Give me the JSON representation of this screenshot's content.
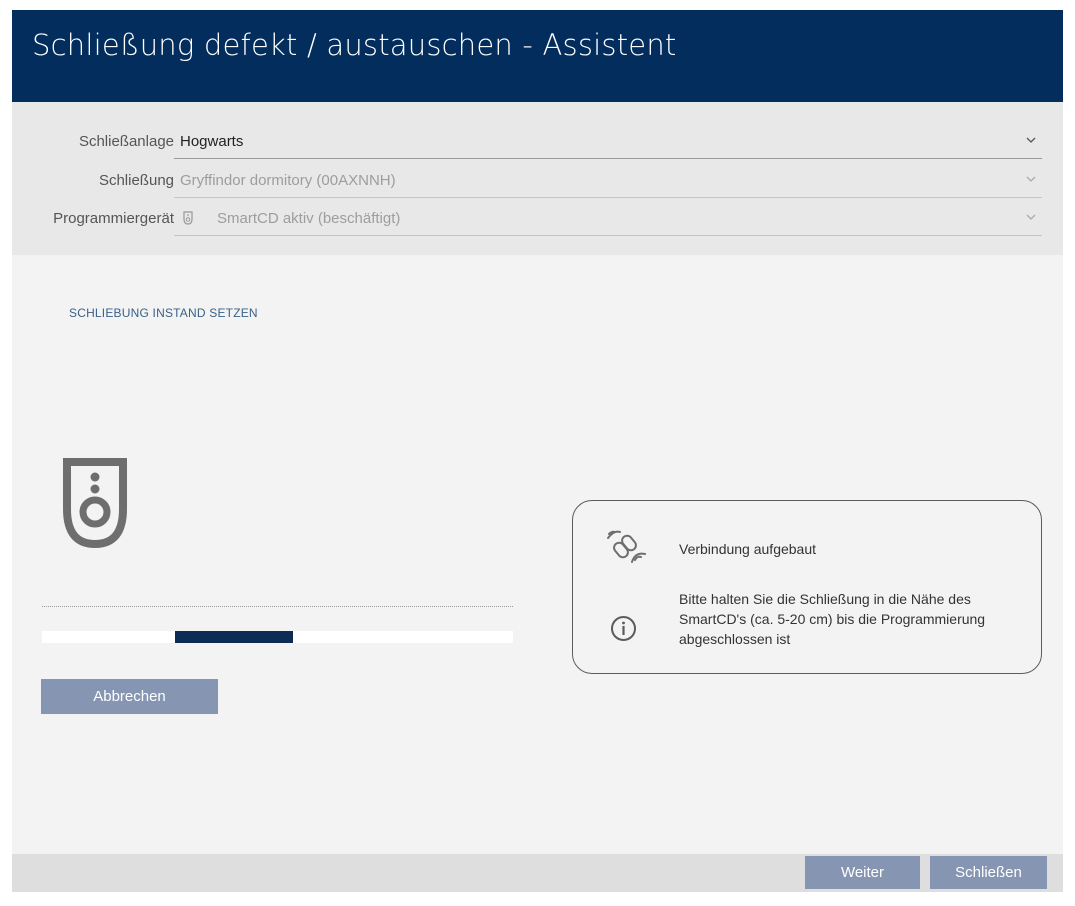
{
  "window": {
    "title": "Schließung defekt / austauschen - Assistent"
  },
  "form": {
    "locking_system": {
      "label": "Schließanlage",
      "value": "Hogwarts"
    },
    "lock": {
      "label": "Schließung",
      "value": "Gryffindor dormitory (00AXNNH)"
    },
    "programming_device": {
      "label": "Programmiergerät",
      "value": "SmartCD aktiv (beschäftigt)"
    }
  },
  "section": {
    "title": "SCHLIEBUNG INSTAND SETZEN"
  },
  "progress": {
    "indeterminate": true
  },
  "cancel_button": "Abbrechen",
  "info": {
    "connection_status": "Verbindung aufgebaut",
    "hint": "Bitte halten Sie die Schließung in die Nähe des SmartCD's (ca. 5-20 cm) bis die Programmierung abgeschlossen ist"
  },
  "footer": {
    "next_button": "Weiter",
    "close_button": "Schließen"
  },
  "icons": {
    "lock": "lock-cylinder-icon",
    "connection": "wireless-link-icon",
    "info": "info-icon",
    "device": "smartcd-device-icon",
    "dropdown": "chevron-down-icon"
  },
  "colors": {
    "titlebar": "#022d5c",
    "accent_button": "#8595b2",
    "progress_fill": "#0a2c55",
    "section_title": "#3a6188"
  }
}
